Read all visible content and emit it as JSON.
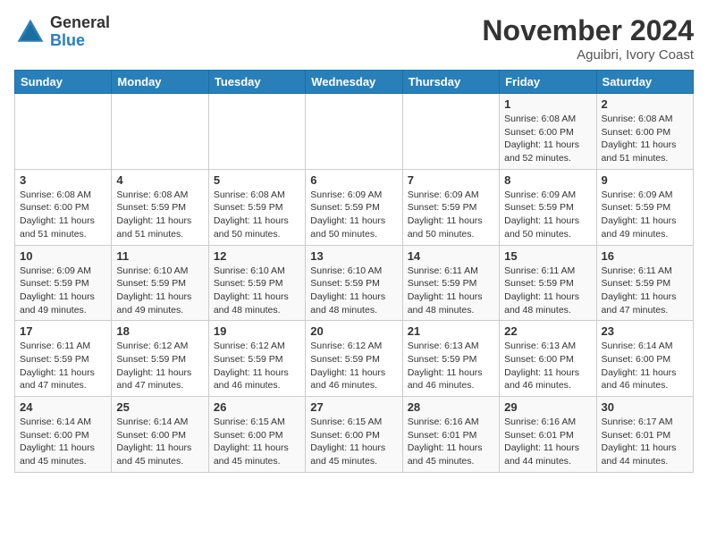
{
  "logo": {
    "general": "General",
    "blue": "Blue"
  },
  "header": {
    "month": "November 2024",
    "location": "Aguibri, Ivory Coast"
  },
  "weekdays": [
    "Sunday",
    "Monday",
    "Tuesday",
    "Wednesday",
    "Thursday",
    "Friday",
    "Saturday"
  ],
  "weeks": [
    [
      {
        "day": "",
        "info": ""
      },
      {
        "day": "",
        "info": ""
      },
      {
        "day": "",
        "info": ""
      },
      {
        "day": "",
        "info": ""
      },
      {
        "day": "",
        "info": ""
      },
      {
        "day": "1",
        "info": "Sunrise: 6:08 AM\nSunset: 6:00 PM\nDaylight: 11 hours and 52 minutes."
      },
      {
        "day": "2",
        "info": "Sunrise: 6:08 AM\nSunset: 6:00 PM\nDaylight: 11 hours and 51 minutes."
      }
    ],
    [
      {
        "day": "3",
        "info": "Sunrise: 6:08 AM\nSunset: 6:00 PM\nDaylight: 11 hours and 51 minutes."
      },
      {
        "day": "4",
        "info": "Sunrise: 6:08 AM\nSunset: 5:59 PM\nDaylight: 11 hours and 51 minutes."
      },
      {
        "day": "5",
        "info": "Sunrise: 6:08 AM\nSunset: 5:59 PM\nDaylight: 11 hours and 50 minutes."
      },
      {
        "day": "6",
        "info": "Sunrise: 6:09 AM\nSunset: 5:59 PM\nDaylight: 11 hours and 50 minutes."
      },
      {
        "day": "7",
        "info": "Sunrise: 6:09 AM\nSunset: 5:59 PM\nDaylight: 11 hours and 50 minutes."
      },
      {
        "day": "8",
        "info": "Sunrise: 6:09 AM\nSunset: 5:59 PM\nDaylight: 11 hours and 50 minutes."
      },
      {
        "day": "9",
        "info": "Sunrise: 6:09 AM\nSunset: 5:59 PM\nDaylight: 11 hours and 49 minutes."
      }
    ],
    [
      {
        "day": "10",
        "info": "Sunrise: 6:09 AM\nSunset: 5:59 PM\nDaylight: 11 hours and 49 minutes."
      },
      {
        "day": "11",
        "info": "Sunrise: 6:10 AM\nSunset: 5:59 PM\nDaylight: 11 hours and 49 minutes."
      },
      {
        "day": "12",
        "info": "Sunrise: 6:10 AM\nSunset: 5:59 PM\nDaylight: 11 hours and 48 minutes."
      },
      {
        "day": "13",
        "info": "Sunrise: 6:10 AM\nSunset: 5:59 PM\nDaylight: 11 hours and 48 minutes."
      },
      {
        "day": "14",
        "info": "Sunrise: 6:11 AM\nSunset: 5:59 PM\nDaylight: 11 hours and 48 minutes."
      },
      {
        "day": "15",
        "info": "Sunrise: 6:11 AM\nSunset: 5:59 PM\nDaylight: 11 hours and 48 minutes."
      },
      {
        "day": "16",
        "info": "Sunrise: 6:11 AM\nSunset: 5:59 PM\nDaylight: 11 hours and 47 minutes."
      }
    ],
    [
      {
        "day": "17",
        "info": "Sunrise: 6:11 AM\nSunset: 5:59 PM\nDaylight: 11 hours and 47 minutes."
      },
      {
        "day": "18",
        "info": "Sunrise: 6:12 AM\nSunset: 5:59 PM\nDaylight: 11 hours and 47 minutes."
      },
      {
        "day": "19",
        "info": "Sunrise: 6:12 AM\nSunset: 5:59 PM\nDaylight: 11 hours and 46 minutes."
      },
      {
        "day": "20",
        "info": "Sunrise: 6:12 AM\nSunset: 5:59 PM\nDaylight: 11 hours and 46 minutes."
      },
      {
        "day": "21",
        "info": "Sunrise: 6:13 AM\nSunset: 5:59 PM\nDaylight: 11 hours and 46 minutes."
      },
      {
        "day": "22",
        "info": "Sunrise: 6:13 AM\nSunset: 6:00 PM\nDaylight: 11 hours and 46 minutes."
      },
      {
        "day": "23",
        "info": "Sunrise: 6:14 AM\nSunset: 6:00 PM\nDaylight: 11 hours and 46 minutes."
      }
    ],
    [
      {
        "day": "24",
        "info": "Sunrise: 6:14 AM\nSunset: 6:00 PM\nDaylight: 11 hours and 45 minutes."
      },
      {
        "day": "25",
        "info": "Sunrise: 6:14 AM\nSunset: 6:00 PM\nDaylight: 11 hours and 45 minutes."
      },
      {
        "day": "26",
        "info": "Sunrise: 6:15 AM\nSunset: 6:00 PM\nDaylight: 11 hours and 45 minutes."
      },
      {
        "day": "27",
        "info": "Sunrise: 6:15 AM\nSunset: 6:00 PM\nDaylight: 11 hours and 45 minutes."
      },
      {
        "day": "28",
        "info": "Sunrise: 6:16 AM\nSunset: 6:01 PM\nDaylight: 11 hours and 45 minutes."
      },
      {
        "day": "29",
        "info": "Sunrise: 6:16 AM\nSunset: 6:01 PM\nDaylight: 11 hours and 44 minutes."
      },
      {
        "day": "30",
        "info": "Sunrise: 6:17 AM\nSunset: 6:01 PM\nDaylight: 11 hours and 44 minutes."
      }
    ]
  ]
}
